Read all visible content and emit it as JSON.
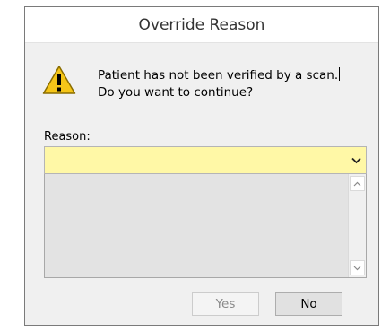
{
  "dialog": {
    "title": "Override Reason",
    "message_line1": "Patient has not been verified by a scan.",
    "message_line2": "Do you want to continue?",
    "reason_label": "Reason:",
    "reason_value": "",
    "reason_options": [],
    "yes_label": "Yes",
    "no_label": "No",
    "yes_enabled": false
  },
  "colors": {
    "reason_field_bg": "#fff8a6",
    "warning_fill": "#f5c518"
  },
  "icons": {
    "warning": "warning-triangle-icon",
    "combo": "chevron-down-icon",
    "scroll_up": "scroll-up-icon",
    "scroll_down": "scroll-down-icon"
  }
}
